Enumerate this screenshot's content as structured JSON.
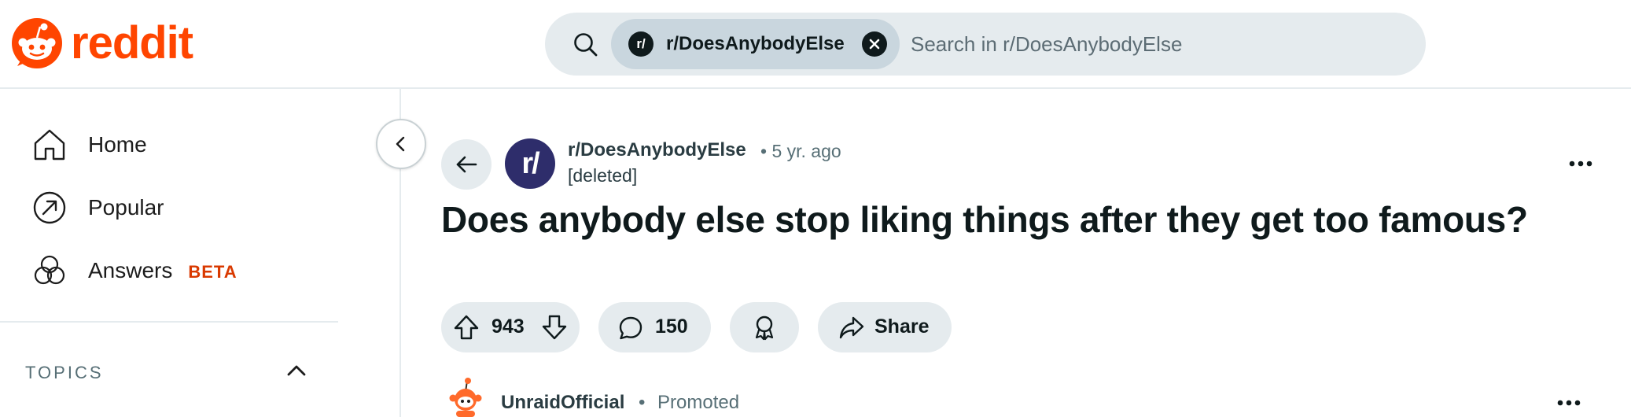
{
  "header": {
    "logo_text": "reddit",
    "brand_color": "#ff4500",
    "search": {
      "chip_avatar": "r/",
      "chip_label": "r/DoesAnybodyElse",
      "placeholder": "Search in r/DoesAnybodyElse"
    }
  },
  "sidebar": {
    "items": [
      {
        "label": "Home",
        "icon": "home-icon"
      },
      {
        "label": "Popular",
        "icon": "popular-icon"
      },
      {
        "label": "Answers",
        "badge": "BETA",
        "icon": "answers-icon"
      }
    ],
    "topics_label": "TOPICS"
  },
  "post": {
    "subreddit_avatar": "r/",
    "subreddit": "r/DoesAnybodyElse",
    "meta": "• 5 yr. ago",
    "author": "[deleted]",
    "title": "Does anybody else stop liking things after they get too famous?",
    "votes": "943",
    "comments": "150",
    "share_label": "Share"
  },
  "promoted": {
    "name": "UnraidOfficial",
    "separator": "•",
    "label": "Promoted"
  }
}
